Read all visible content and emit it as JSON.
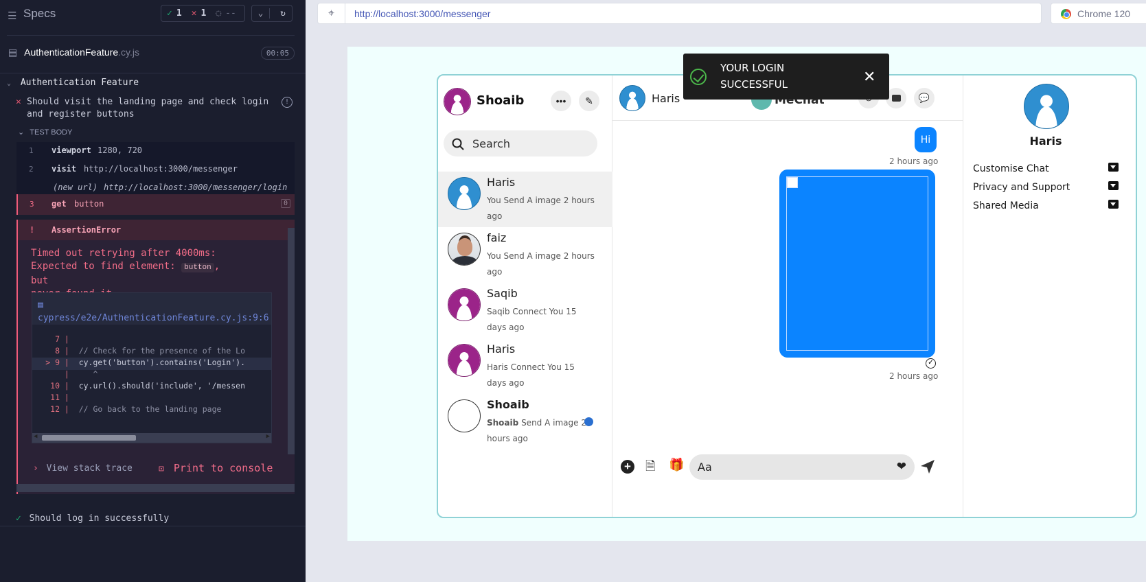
{
  "runner": {
    "specs_title": "Specs",
    "passed_count": "1",
    "failed_count": "1",
    "pending_count": "--",
    "spec_file_name": "AuthenticationFeature",
    "spec_file_ext": ".cy.js",
    "duration": "00:05",
    "suite_title": "Authentication Feature",
    "test1_title": "Should visit the landing page and check login and register buttons",
    "test_body_label": "TEST BODY",
    "commands": [
      {
        "num": "1",
        "name": "viewport",
        "arg": "1280, 720"
      },
      {
        "num": "2",
        "name": "visit",
        "arg": "http://localhost:3000/messenger"
      },
      {
        "num": "",
        "name": "(new url)",
        "arg": "http://localhost:3000/messenger/login"
      },
      {
        "num": "3",
        "name": "get",
        "arg": "button",
        "badge": "0"
      }
    ],
    "error_marker": "!",
    "error_name": "AssertionError",
    "error_line1": "Timed out retrying after 4000ms:",
    "error_line2_a": "Expected to find element:",
    "error_code": "button",
    "error_line2_b": ", but",
    "error_line3": "never found it.",
    "code_path": "cypress/e2e/AuthenticationFeature.cy.js:9:6",
    "code_lines": [
      {
        "n": "7",
        "text": ""
      },
      {
        "n": "8",
        "text": "  // Check for the presence of the Lo"
      },
      {
        "n": "> 9",
        "text": "  cy.get('button').contains('Login')."
      },
      {
        "n": "",
        "text": "     ^"
      },
      {
        "n": "10",
        "text": "  cy.url().should('include', '/messen"
      },
      {
        "n": "11",
        "text": ""
      },
      {
        "n": "12",
        "text": "  // Go back to the landing page"
      }
    ],
    "view_stack": "View stack trace",
    "print_console": "Print to console",
    "test2_title": "Should log in successfully"
  },
  "browser": {
    "url": "http://localhost:3000/messenger",
    "browser_name": "Chrome 120"
  },
  "toast": {
    "line1": "YOUR LOGIN",
    "line2": "SUCCESSFUL"
  },
  "app": {
    "user_name": "Shoaib",
    "search_placeholder": "Search",
    "contacts": [
      {
        "name": "Haris",
        "msg": "You Send A image 2 hours ago",
        "avatar": "blue"
      },
      {
        "name": "faiz",
        "msg": "You Send A image 2 hours ago",
        "avatar": "photo"
      },
      {
        "name": "Saqib",
        "msg": "Saqib Connect You 15 days ago",
        "avatar": "pink"
      },
      {
        "name": "Haris",
        "msg": "Haris Connect You 15 days ago",
        "avatar": "pink"
      },
      {
        "name": "Shoaib",
        "msg_bold": "Shoaib",
        "msg": "Send A image 2 hours ago",
        "avatar": "broken",
        "unread": true
      }
    ],
    "chat_partner": "Haris",
    "brand": "MeChat",
    "message_text": "Hi",
    "message_time1": "2 hours ago",
    "message_time2": "2 hours ago",
    "input_placeholder": "Aa",
    "profile_name": "Haris",
    "options": [
      "Customise Chat",
      "Privacy and Support",
      "Shared Media"
    ],
    "colors": {
      "accent": "#0b84ff",
      "pink_avatar": "#9b2489",
      "blue_avatar": "#2f8fd0"
    }
  }
}
